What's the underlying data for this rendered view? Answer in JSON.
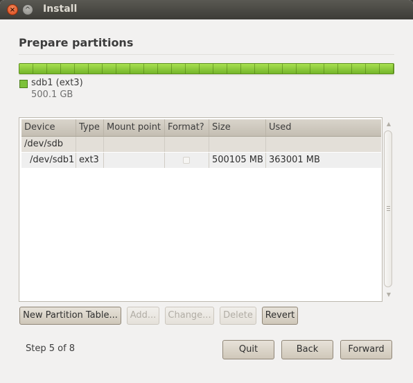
{
  "window": {
    "title": "Install",
    "close_glyph": "×",
    "minimize_glyph": "^"
  },
  "page": {
    "heading": "Prepare partitions"
  },
  "partition_bar": {
    "color": "#8ed13c",
    "fill_fraction": 1.0
  },
  "legend": {
    "name": "sdb1 (ext3)",
    "size": "500.1 GB",
    "color": "#7dc13a"
  },
  "table": {
    "columns": [
      "Device",
      "Type",
      "Mount point",
      "Format?",
      "Size",
      "Used"
    ],
    "group": {
      "device": "/dev/sdb"
    },
    "rows": [
      {
        "device": "/dev/sdb1",
        "type": "ext3",
        "mount": "",
        "format": false,
        "size": "500105 MB",
        "used": "363001 MB"
      }
    ]
  },
  "scrollbar": {
    "up_glyph": "▲",
    "down_glyph": "▼"
  },
  "partition_buttons": {
    "new_table": "New Partition Table...",
    "add": "Add...",
    "change": "Change...",
    "delete": "Delete",
    "revert": "Revert"
  },
  "footer": {
    "step": "Step 5 of 8",
    "quit": "Quit",
    "back": "Back",
    "forward": "Forward"
  },
  "colors": {
    "titlebar": "#3c3b37",
    "window_bg": "#f2f1f0",
    "close_button": "#e25a24"
  }
}
